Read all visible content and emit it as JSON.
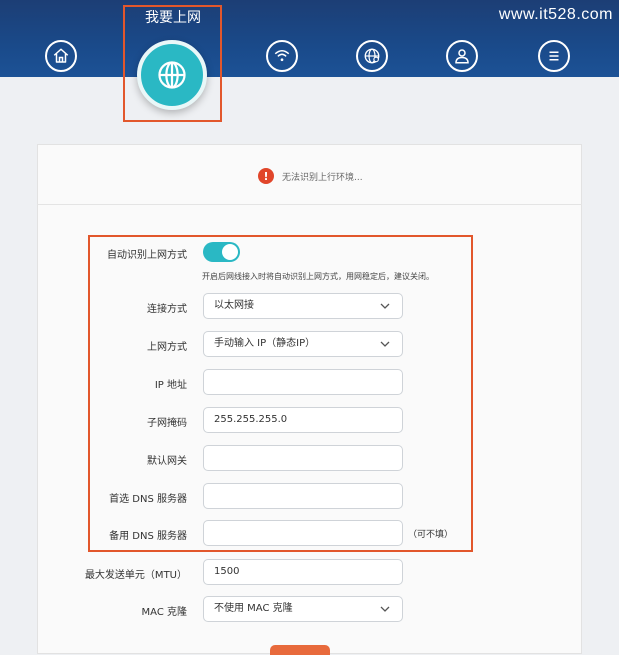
{
  "watermark": "www.it528.com",
  "nav": {
    "active_label": "我要上网",
    "items": [
      {
        "icon": "home-icon"
      },
      {
        "icon": "globe-icon",
        "active": true
      },
      {
        "icon": "wifi-icon"
      },
      {
        "icon": "globe-settings-icon"
      },
      {
        "icon": "user-icon"
      },
      {
        "icon": "menu-icon"
      }
    ]
  },
  "alert": {
    "text": "无法识别上行环境..."
  },
  "form": {
    "auto_detect_label": "自动识别上网方式",
    "auto_detect_on": true,
    "auto_detect_hint": "开启后网线接入时将自动识别上网方式，用网稳定后，建议关闭。",
    "connection_label": "连接方式",
    "connection_value": "以太网接",
    "internet_label": "上网方式",
    "internet_value": "手动输入 IP（静态IP）",
    "ip_label": "IP 地址",
    "ip_value": "",
    "mask_label": "子网掩码",
    "mask_value": "255.255.255.0",
    "gateway_label": "默认网关",
    "gateway_value": "",
    "dns1_label": "首选 DNS 服务器",
    "dns1_value": "",
    "dns2_label": "备用 DNS 服务器",
    "dns2_value": "",
    "dns2_optional": "（可不填）",
    "mtu_label": "最大发送单元（MTU）",
    "mtu_value": "1500",
    "mac_label": "MAC 克隆",
    "mac_value": "不使用 MAC 克隆"
  },
  "colors": {
    "header": "#1a4a8a",
    "accent": "#2ab8c4",
    "highlight": "#e2572c",
    "alert": "#e1462a"
  }
}
